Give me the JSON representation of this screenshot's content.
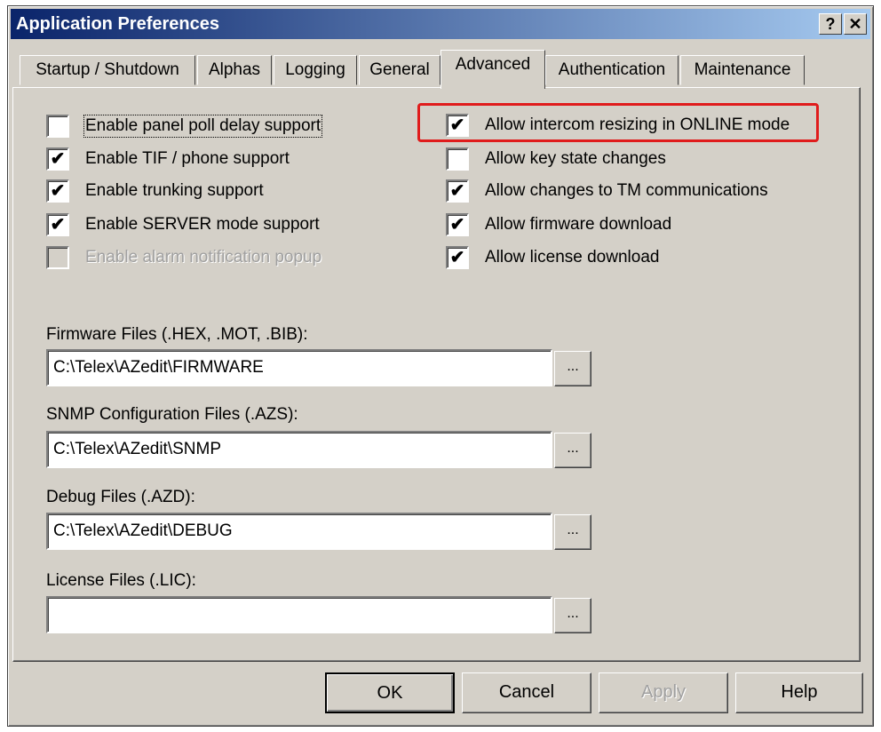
{
  "window": {
    "title": "Application Preferences",
    "help_button": "?",
    "close_button": "✕"
  },
  "tabs": [
    {
      "label": "Startup / Shutdown"
    },
    {
      "label": "Alphas"
    },
    {
      "label": "Logging"
    },
    {
      "label": "General"
    },
    {
      "label": "Advanced",
      "active": true
    },
    {
      "label": "Authentication"
    },
    {
      "label": "Maintenance"
    }
  ],
  "left_options": [
    {
      "label": "Enable panel poll delay support",
      "checked": false,
      "enabled": true
    },
    {
      "label": "Enable TIF / phone support",
      "checked": true,
      "enabled": true
    },
    {
      "label": "Enable trunking support",
      "checked": true,
      "enabled": true
    },
    {
      "label": "Enable SERVER mode support",
      "checked": true,
      "enabled": true
    },
    {
      "label": "Enable alarm notification popup",
      "checked": false,
      "enabled": false
    }
  ],
  "right_options": [
    {
      "label": "Allow intercom resizing in ONLINE mode",
      "checked": true,
      "enabled": true
    },
    {
      "label": "Allow key state changes",
      "checked": false,
      "enabled": true
    },
    {
      "label": "Allow changes to TM communications",
      "checked": true,
      "enabled": true
    },
    {
      "label": "Allow firmware download",
      "checked": true,
      "enabled": true
    },
    {
      "label": "Allow license download",
      "checked": true,
      "enabled": true
    }
  ],
  "check_mark": "✔",
  "paths": {
    "firmware": {
      "label": "Firmware Files (.HEX, .MOT, .BIB):",
      "value": "C:\\Telex\\AZedit\\FIRMWARE"
    },
    "snmp": {
      "label": "SNMP Configuration Files (.AZS):",
      "value": "C:\\Telex\\AZedit\\SNMP"
    },
    "debug": {
      "label": "Debug Files (.AZD):",
      "value": "C:\\Telex\\AZedit\\DEBUG"
    },
    "license": {
      "label": "License Files (.LIC):",
      "value": ""
    }
  },
  "browse_label": "...",
  "buttons": {
    "ok": "OK",
    "cancel": "Cancel",
    "apply": "Apply",
    "help": "Help"
  },
  "colors": {
    "face": "#d4d0c8",
    "title_start": "#0a246a",
    "title_end": "#a6caf0",
    "highlight": "#e01c1c"
  }
}
